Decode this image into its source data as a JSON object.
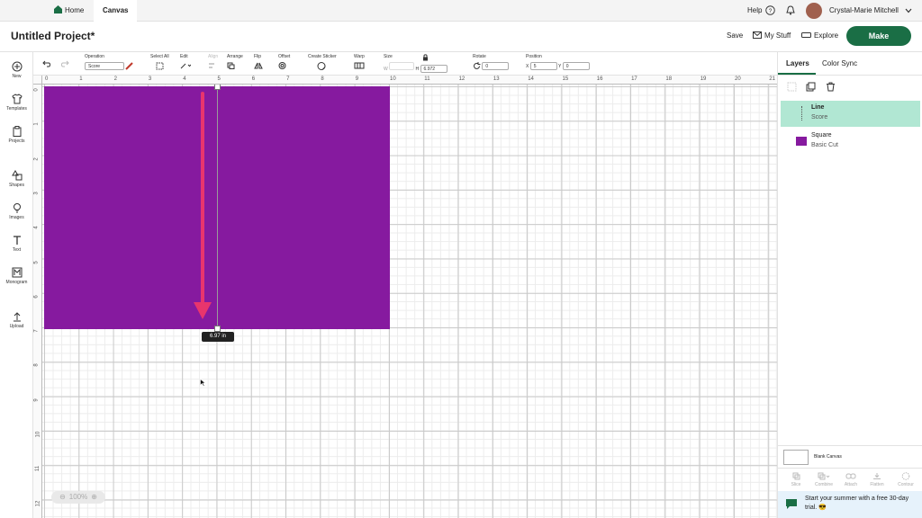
{
  "tabs": {
    "home": "Home",
    "canvas": "Canvas"
  },
  "user": {
    "help": "Help",
    "name": "Crystal-Marie Mitchell"
  },
  "header": {
    "project_title": "Untitled Project*",
    "save": "Save",
    "my_stuff": "My Stuff",
    "explore": "Explore",
    "make": "Make"
  },
  "left_rail": {
    "new": "New",
    "templates": "Templates",
    "projects": "Projects",
    "shapes": "Shapes",
    "images": "Images",
    "text": "Text",
    "monogram": "Monogram",
    "upload": "Upload"
  },
  "toolbar": {
    "operation_label": "Operation",
    "operation_value": "Score",
    "select_all": "Select All",
    "edit": "Edit",
    "align": "Align",
    "arrange": "Arrange",
    "flip": "Flip",
    "offset": "Offset",
    "create_sticker": "Create Sticker",
    "warp": "Warp",
    "size_label": "Size",
    "w_label": "W",
    "h_label": "H",
    "h_value": "6.972",
    "rotate_label": "Rotate",
    "rotate_value": "0",
    "position_label": "Position",
    "x_label": "X",
    "x_value": "5",
    "y_label": "Y",
    "y_value": "0"
  },
  "ruler": {
    "top": [
      "0",
      "1",
      "2",
      "3",
      "4",
      "5",
      "6",
      "7",
      "8",
      "9",
      "10",
      "11",
      "12",
      "13",
      "14",
      "15",
      "16",
      "17",
      "18",
      "19",
      "20",
      "21"
    ],
    "left": [
      "0",
      "1",
      "2",
      "3",
      "4",
      "5",
      "6",
      "7",
      "8",
      "9",
      "10",
      "11",
      "12"
    ]
  },
  "canvas": {
    "dimension_badge": "6.97 in",
    "zoom": "100%",
    "shape_color": "#861a9f",
    "arrow_color": "#e8356d"
  },
  "panel": {
    "tab_layers": "Layers",
    "tab_color_sync": "Color Sync",
    "layers": [
      {
        "name": "Line",
        "type": "Score"
      },
      {
        "name": "Square",
        "type": "Basic Cut",
        "color": "#861a9f"
      }
    ],
    "blank_canvas": "Blank Canvas",
    "bottom_actions": [
      "Slice",
      "Combine",
      "Attach",
      "Flatten",
      "Contour"
    ],
    "promo": "Start your summer with a free 30-day trial. 😎"
  }
}
